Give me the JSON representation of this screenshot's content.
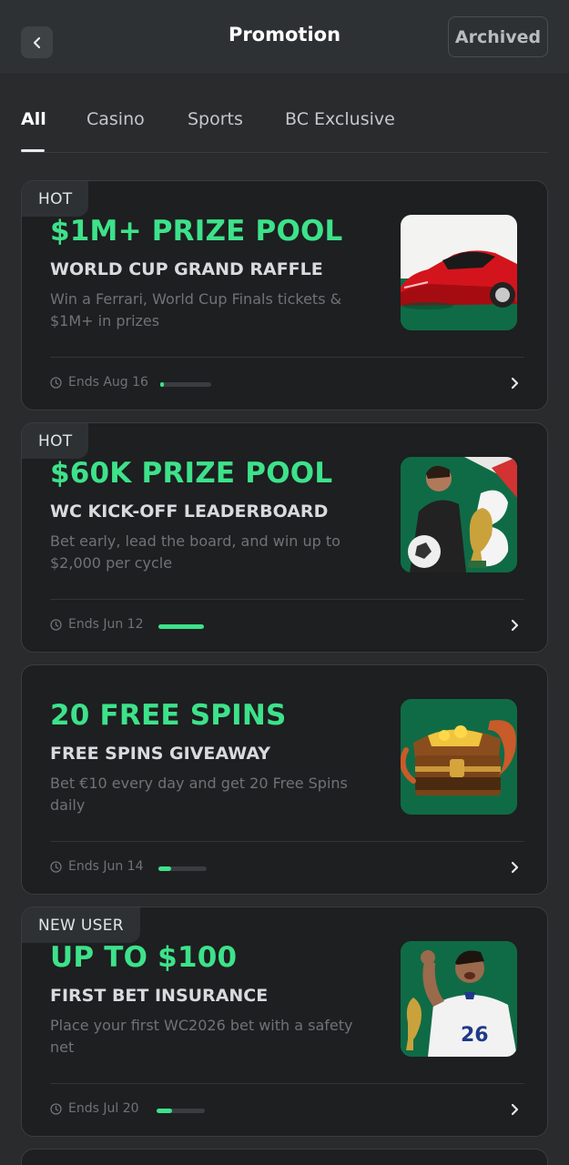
{
  "header": {
    "title": "Promotion",
    "archived_label": "Archived"
  },
  "tabs": [
    {
      "label": "All",
      "active": true
    },
    {
      "label": "Casino",
      "active": false
    },
    {
      "label": "Sports",
      "active": false
    },
    {
      "label": "BC Exclusive",
      "active": false
    }
  ],
  "colors": {
    "accent": "#3de28a",
    "background": "#292b2c",
    "card": "#1d1f20"
  },
  "promotions": [
    {
      "badge": "HOT",
      "headline": "$1M+ PRIZE POOL",
      "subtitle": "WORLD CUP GRAND RAFFLE",
      "description": "Win a Ferrari, World Cup Finals tickets & $1M+ in prizes",
      "ends": "Ends Aug 16",
      "progress": 0.08,
      "image": "red-sports-car"
    },
    {
      "badge": "HOT",
      "headline": "$60K PRIZE POOL",
      "subtitle": "WC KICK-OFF LEADERBOARD",
      "description": "Bet early, lead the board, and win up to $2,000 per cycle",
      "ends": "Ends Jun 12",
      "progress": 1.0,
      "image": "football-player-with-trophy"
    },
    {
      "badge": "",
      "headline": "20 FREE SPINS",
      "subtitle": "FREE SPINS GIVEAWAY",
      "description": "Bet €10 every day and get 20 Free Spins daily",
      "ends": "Ends Jun 14",
      "progress": 0.27,
      "image": "deadliest-sea-treasure-chest"
    },
    {
      "badge": "NEW USER",
      "headline": "UP TO $100",
      "subtitle": "FIRST BET INSURANCE",
      "description": "Place your first WC2026 bet with a safety net",
      "ends": "Ends Jul 20",
      "progress": 0.33,
      "image": "celebrating-player-26"
    }
  ]
}
